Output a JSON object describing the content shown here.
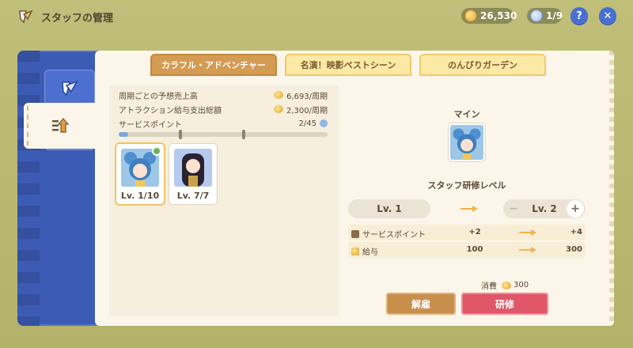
{
  "header": {
    "title": "スタッフの管理",
    "coins": "26,530",
    "staff_count": "1/9",
    "help_label": "?",
    "close_label": "✕"
  },
  "tabs": [
    {
      "label": "カラフル・アドベンチャー",
      "active": true
    },
    {
      "label": "名演！映影ベストシーン",
      "active": false
    },
    {
      "label": "のんびりガーデン",
      "active": false
    }
  ],
  "stats": {
    "revenue_label": "周期ごとの予想売上高",
    "revenue_value": "6,693/周期",
    "salary_label": "アトラクション給与支出総額",
    "salary_value": "2,300/周期",
    "service_label": "サービスポイント",
    "service_value": "2/45",
    "service_progress": 0.044
  },
  "staff_cards": [
    {
      "level": "Lv. 1/10",
      "selected": true
    },
    {
      "level": "Lv. 7/7",
      "selected": false
    }
  ],
  "detail": {
    "name": "マイン",
    "training_title": "スタッフ研修レベル",
    "current_level": "Lv. 1",
    "next_level": "Lv. 2",
    "minus": "−",
    "plus": "+",
    "rows": [
      {
        "label": "サービスポイント",
        "from": "+2",
        "to": "+4"
      },
      {
        "label": "給与",
        "from": "100",
        "to": "300"
      }
    ],
    "cost_label": "消費",
    "cost_value": "300",
    "dismiss_label": "解雇",
    "train_label": "研修"
  },
  "icons": {
    "title": "staff-manage-icon",
    "coin": "coin-icon",
    "staff": "staff-icon",
    "sidebar": [
      "feather-icon",
      "staff-gear-icon",
      "level-up-icon"
    ]
  },
  "colors": {
    "accent": "#d49b52",
    "primary_action": "#e0576a",
    "secondary_action": "#c88f4c",
    "sidebar": "#3c5bb4"
  }
}
